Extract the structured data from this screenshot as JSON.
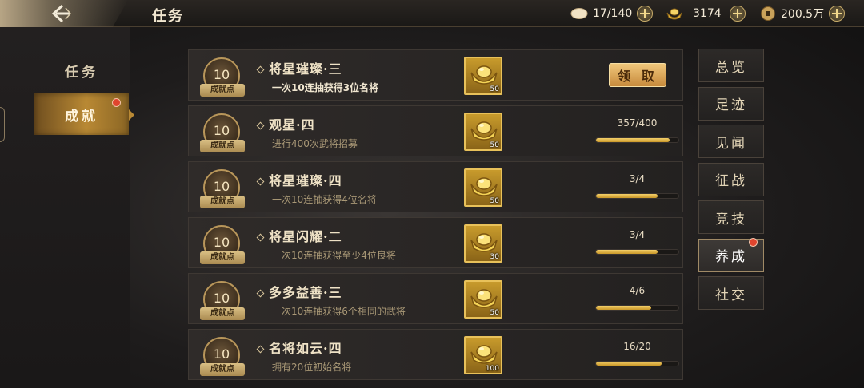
{
  "header": {
    "title": "任务",
    "resources": [
      {
        "icon": "egg-icon",
        "value": "17/140"
      },
      {
        "icon": "gold-ingot-icon",
        "value": "3174"
      },
      {
        "icon": "coin-icon",
        "value": "200.5万"
      }
    ]
  },
  "left_nav": {
    "items": [
      {
        "label": "任务",
        "active": false
      },
      {
        "label": "成就",
        "active": true,
        "notification": true
      }
    ]
  },
  "tasks": [
    {
      "points": "10",
      "points_label": "成就点",
      "name": "将星璀璨·三",
      "desc": "一次10连抽获得3位名将",
      "reward_count": "50",
      "status": "claim",
      "claim_label": "领 取"
    },
    {
      "points": "10",
      "points_label": "成就点",
      "name": "观星·四",
      "desc": "进行400次武将招募",
      "reward_count": "50",
      "progress": "357/400",
      "progress_ratio": 0.8925
    },
    {
      "points": "10",
      "points_label": "成就点",
      "name": "将星璀璨·四",
      "desc": "一次10连抽获得4位名将",
      "reward_count": "50",
      "progress": "3/4",
      "progress_ratio": 0.75
    },
    {
      "points": "10",
      "points_label": "成就点",
      "name": "将星闪耀·二",
      "desc": "一次10连抽获得至少4位良将",
      "reward_count": "30",
      "progress": "3/4",
      "progress_ratio": 0.75
    },
    {
      "points": "10",
      "points_label": "成就点",
      "name": "多多益善·三",
      "desc": "一次10连抽获得6个相同的武将",
      "reward_count": "50",
      "progress": "4/6",
      "progress_ratio": 0.667
    },
    {
      "points": "10",
      "points_label": "成就点",
      "name": "名将如云·四",
      "desc": "拥有20位初始名将",
      "reward_count": "100",
      "progress": "16/20",
      "progress_ratio": 0.8
    }
  ],
  "right_tabs": [
    {
      "label": "总览"
    },
    {
      "label": "足迹"
    },
    {
      "label": "见闻"
    },
    {
      "label": "征战"
    },
    {
      "label": "竞技"
    },
    {
      "label": "养成",
      "active": true,
      "notification": true
    },
    {
      "label": "社交"
    }
  ],
  "colors": {
    "accent_gold": "#c99728",
    "active_tab": "#b98934",
    "notification": "#e0452e"
  }
}
